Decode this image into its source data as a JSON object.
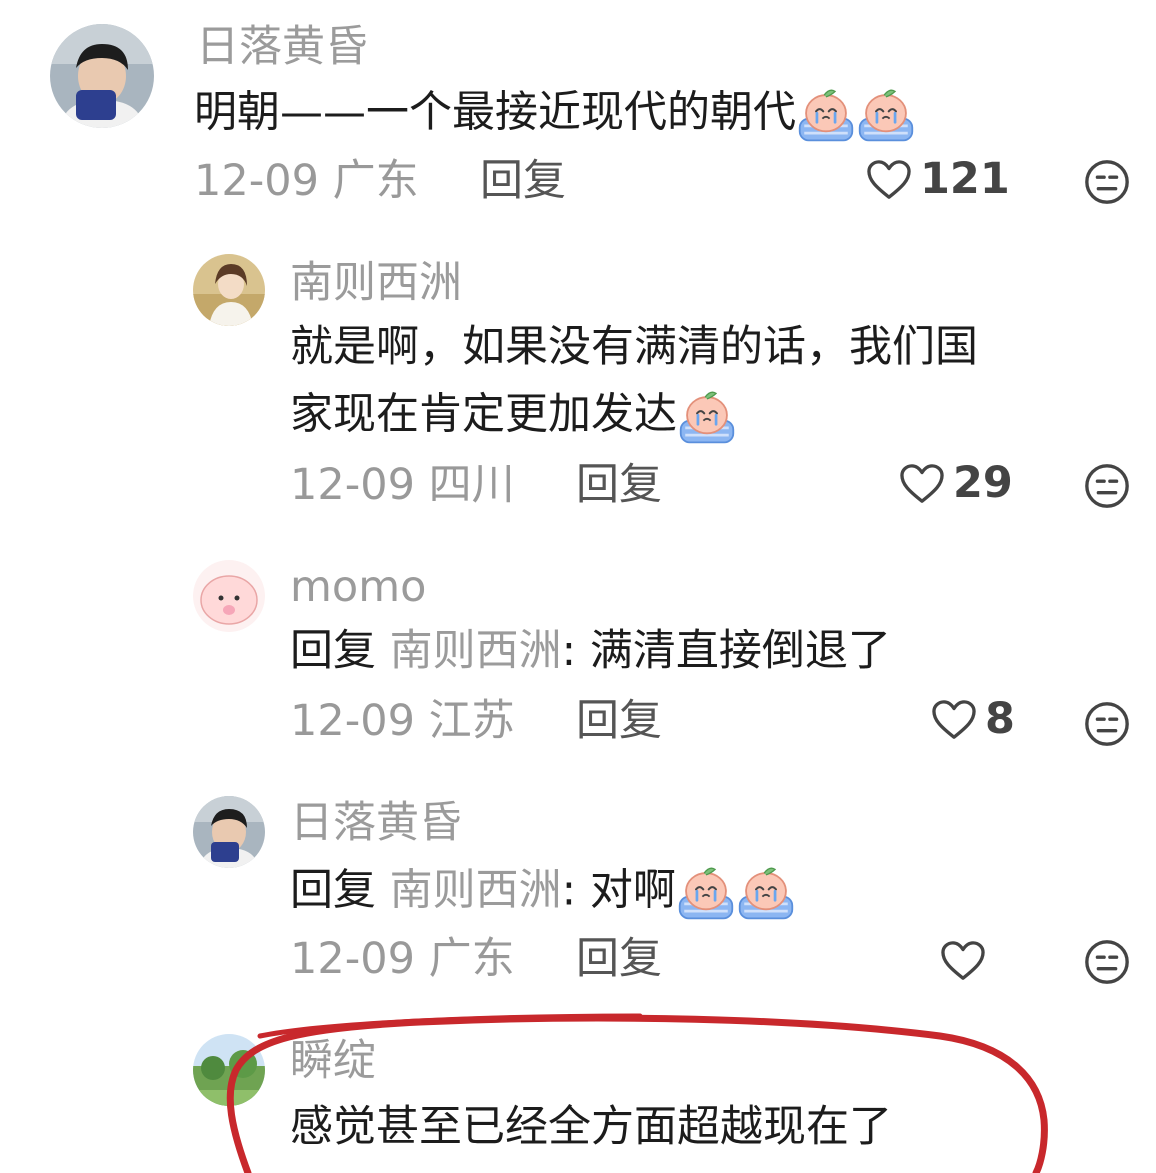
{
  "comments": [
    {
      "username": "日落黄昏",
      "text": "明朝——一个最接近现代的朝代",
      "emoji_count": 2,
      "date": "12-09",
      "location": "广东",
      "reply_label": "回复",
      "likes": "121"
    },
    {
      "username": "南则西洲",
      "text_line1": "就是啊，如果没有满清的话，我们国",
      "text_line2": "家现在肯定更加发达",
      "emoji_count": 1,
      "date": "12-09",
      "location": "四川",
      "reply_label": "回复",
      "likes": "29"
    },
    {
      "username": "momo",
      "reply_prefix": "回复",
      "reply_to": "南则西洲",
      "text": ": 满清直接倒退了",
      "date": "12-09",
      "location": "江苏",
      "reply_label": "回复",
      "likes": "8"
    },
    {
      "username": "日落黄昏",
      "reply_prefix": "回复",
      "reply_to": "南则西洲",
      "text": ": 对啊",
      "emoji_count": 2,
      "date": "12-09",
      "location": "广东",
      "reply_label": "回复",
      "likes": ""
    },
    {
      "username": "瞬绽",
      "text": "感觉甚至已经全方面超越现在了"
    }
  ],
  "icons": {
    "like": "heart-outline-icon",
    "dislike": "neutral-face-icon",
    "emoji": "crying-peach-emoji"
  },
  "colors": {
    "annotation_circle": "#c8282c",
    "name": "#9b9b9b",
    "meta": "#999999"
  }
}
